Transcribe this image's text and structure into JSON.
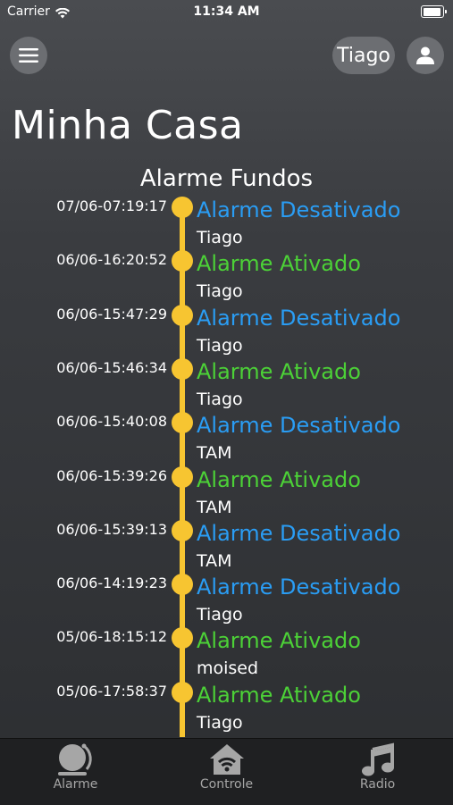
{
  "status_bar": {
    "carrier": "Carrier",
    "time": "11:34 AM"
  },
  "header": {
    "user_label": "Tiago"
  },
  "page": {
    "title": "Minha Casa",
    "section": "Alarme Fundos"
  },
  "colors": {
    "deactivated": "#2a9df4",
    "activated": "#4cd137",
    "timeline": "#f7c531"
  },
  "events": [
    {
      "timestamp": "07/06-07:19:17",
      "status": "Alarme Desativado",
      "type": "deactivated",
      "user": "Tiago"
    },
    {
      "timestamp": "06/06-16:20:52",
      "status": "Alarme Ativado",
      "type": "activated",
      "user": "Tiago"
    },
    {
      "timestamp": "06/06-15:47:29",
      "status": "Alarme Desativado",
      "type": "deactivated",
      "user": "Tiago"
    },
    {
      "timestamp": "06/06-15:46:34",
      "status": "Alarme Ativado",
      "type": "activated",
      "user": "Tiago"
    },
    {
      "timestamp": "06/06-15:40:08",
      "status": "Alarme Desativado",
      "type": "deactivated",
      "user": "TAM"
    },
    {
      "timestamp": "06/06-15:39:26",
      "status": "Alarme Ativado",
      "type": "activated",
      "user": "TAM"
    },
    {
      "timestamp": "06/06-15:39:13",
      "status": "Alarme Desativado",
      "type": "deactivated",
      "user": "TAM"
    },
    {
      "timestamp": "06/06-14:19:23",
      "status": "Alarme Desativado",
      "type": "deactivated",
      "user": "Tiago"
    },
    {
      "timestamp": "05/06-18:15:12",
      "status": "Alarme Ativado",
      "type": "activated",
      "user": "moised"
    },
    {
      "timestamp": "05/06-17:58:37",
      "status": "Alarme Ativado",
      "type": "activated",
      "user": "Tiago"
    }
  ],
  "tabs": [
    {
      "label": "Alarme",
      "icon": "alarm-bell-icon"
    },
    {
      "label": "Controle",
      "icon": "home-wifi-icon"
    },
    {
      "label": "Radio",
      "icon": "music-note-icon"
    }
  ]
}
